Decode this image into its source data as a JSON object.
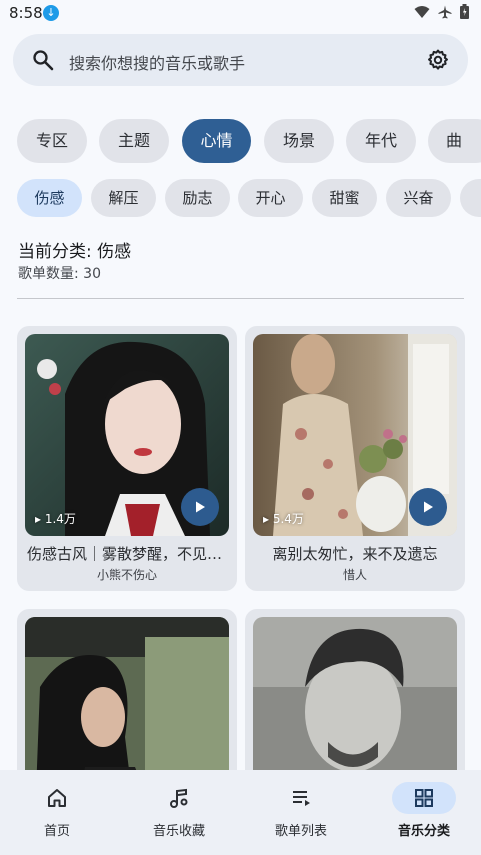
{
  "status_bar": {
    "time": "8:58",
    "download_badge": "↓"
  },
  "search": {
    "placeholder": "搜索你想搜的音乐或歌手"
  },
  "categories": [
    "专区",
    "主题",
    "心情",
    "场景",
    "年代",
    "曲"
  ],
  "active_category": "心情",
  "subcategories": [
    "伤感",
    "解压",
    "励志",
    "开心",
    "甜蜜",
    "兴奋"
  ],
  "active_subcategory": "伤感",
  "current": {
    "title": "当前分类: 伤感",
    "count": "歌单数量: 30"
  },
  "playlists": [
    {
      "title": "伤感古风｜雾散梦醒，不见来时路",
      "artist": "小熊不伤心",
      "plays": "1.4万"
    },
    {
      "title": "离别太匆忙，来不及遗忘",
      "artist": "惜人",
      "plays": "5.4万"
    },
    {
      "title": "",
      "artist": "",
      "plays": ""
    },
    {
      "title": "",
      "artist": "",
      "plays": ""
    }
  ],
  "nav": [
    {
      "label": "首页",
      "icon": "home-icon"
    },
    {
      "label": "音乐收藏",
      "icon": "music-note-icon"
    },
    {
      "label": "歌单列表",
      "icon": "playlist-icon"
    },
    {
      "label": "音乐分类",
      "icon": "grid-icon"
    }
  ],
  "active_nav": "音乐分类",
  "colors": {
    "accent": "#2f5f94",
    "chip_bg": "#e1e3e9",
    "active_sub_bg": "#d2e3fb",
    "page_bg": "#f7f9fd"
  }
}
